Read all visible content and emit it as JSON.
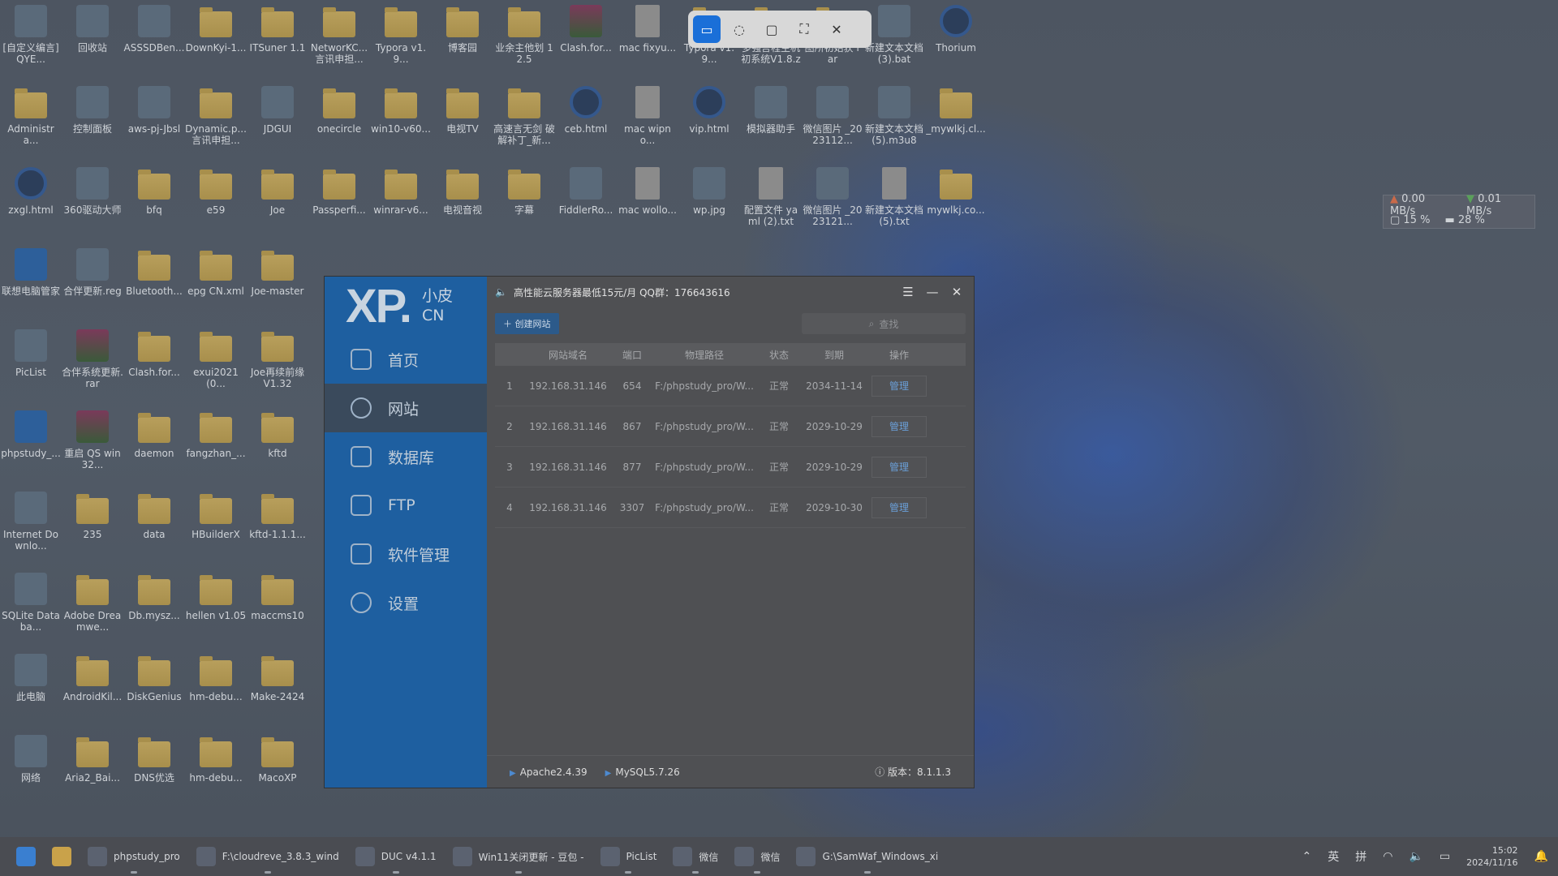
{
  "desktop": {
    "icons": [
      {
        "label": "[自定义编言] QYE...",
        "kind": "app",
        "col": 0,
        "row": 0
      },
      {
        "label": "回收站",
        "kind": "app",
        "col": 1,
        "row": 0
      },
      {
        "label": "ASSSDBen...",
        "kind": "app",
        "col": 2,
        "row": 0
      },
      {
        "label": "DownKyi-1...",
        "kind": "folder",
        "col": 3,
        "row": 0
      },
      {
        "label": "ITSuner 1.1",
        "kind": "folder",
        "col": 4,
        "row": 0
      },
      {
        "label": "NetworKC... 言讯申担...",
        "kind": "folder",
        "col": 5,
        "row": 0
      },
      {
        "label": "Typora v1.9...",
        "kind": "folder",
        "col": 6,
        "row": 0
      },
      {
        "label": "博客园",
        "kind": "folder",
        "col": 7,
        "row": 0
      },
      {
        "label": "业余主他划 12.5",
        "kind": "folder",
        "col": 8,
        "row": 0
      },
      {
        "label": "Clash.for...",
        "kind": "winrar",
        "col": 9,
        "row": 0
      },
      {
        "label": "mac fixyu...",
        "kind": "file",
        "col": 10,
        "row": 0
      },
      {
        "label": "Typora v1.9...",
        "kind": "folder",
        "col": 11,
        "row": 0
      },
      {
        "label": "多强言程主机 初系统V1.8.zip",
        "kind": "folder",
        "col": 12,
        "row": 0
      },
      {
        "label": "图所初始获 rar",
        "kind": "folder",
        "col": 13,
        "row": 0
      },
      {
        "label": "新建文本文档 (3).bat",
        "kind": "app",
        "col": 14,
        "row": 0
      },
      {
        "label": "Thorium",
        "kind": "circle",
        "col": 15,
        "row": 0
      },
      {
        "label": "Administra...",
        "kind": "folder",
        "col": 0,
        "row": 1
      },
      {
        "label": "控制面板",
        "kind": "app",
        "col": 1,
        "row": 1
      },
      {
        "label": "aws-pj-Jbsl",
        "kind": "app",
        "col": 2,
        "row": 1
      },
      {
        "label": "Dynamic.p... 言讯申担...",
        "kind": "folder",
        "col": 3,
        "row": 1
      },
      {
        "label": "JDGUI",
        "kind": "app",
        "col": 4,
        "row": 1
      },
      {
        "label": "onecircle",
        "kind": "folder",
        "col": 5,
        "row": 1
      },
      {
        "label": "win10-v60...",
        "kind": "folder",
        "col": 6,
        "row": 1
      },
      {
        "label": "电视TV",
        "kind": "folder",
        "col": 7,
        "row": 1
      },
      {
        "label": "高速言无剑 破解补丁_新...",
        "kind": "folder",
        "col": 8,
        "row": 1
      },
      {
        "label": "ceb.html",
        "kind": "circle",
        "col": 9,
        "row": 1
      },
      {
        "label": "mac wipno...",
        "kind": "file",
        "col": 10,
        "row": 1
      },
      {
        "label": "vip.html",
        "kind": "circle",
        "col": 11,
        "row": 1
      },
      {
        "label": "模拟器助手",
        "kind": "app",
        "col": 12,
        "row": 1
      },
      {
        "label": "微信图片 _2023112...",
        "kind": "app",
        "col": 13,
        "row": 1
      },
      {
        "label": "新建文本文档 (5).m3u8",
        "kind": "app",
        "col": 14,
        "row": 1
      },
      {
        "label": "_mywlkj.cl...",
        "kind": "folder",
        "col": 15,
        "row": 1
      },
      {
        "label": "zxgl.html",
        "kind": "circle",
        "col": 0,
        "row": 2
      },
      {
        "label": "360驱动大师",
        "kind": "app",
        "col": 1,
        "row": 2
      },
      {
        "label": "bfq",
        "kind": "folder",
        "col": 2,
        "row": 2
      },
      {
        "label": "e59",
        "kind": "folder",
        "col": 3,
        "row": 2
      },
      {
        "label": "Joe",
        "kind": "folder",
        "col": 4,
        "row": 2
      },
      {
        "label": "Passperfi...",
        "kind": "folder",
        "col": 5,
        "row": 2
      },
      {
        "label": "winrar-v6...",
        "kind": "folder",
        "col": 6,
        "row": 2
      },
      {
        "label": "电视音视",
        "kind": "folder",
        "col": 7,
        "row": 2
      },
      {
        "label": "字幕",
        "kind": "folder",
        "col": 8,
        "row": 2
      },
      {
        "label": "FiddlerRo...",
        "kind": "app",
        "col": 9,
        "row": 2
      },
      {
        "label": "mac wollo...",
        "kind": "file",
        "col": 10,
        "row": 2
      },
      {
        "label": "wp.jpg",
        "kind": "app",
        "col": 11,
        "row": 2
      },
      {
        "label": "配置文件 yaml (2).txt",
        "kind": "file",
        "col": 12,
        "row": 2
      },
      {
        "label": "微信图片 _2023121...",
        "kind": "app",
        "col": 13,
        "row": 2
      },
      {
        "label": "新建文本文档 (5).txt",
        "kind": "file",
        "col": 14,
        "row": 2
      },
      {
        "label": "mywlkj.co...",
        "kind": "folder",
        "col": 15,
        "row": 2
      },
      {
        "label": "联想电脑管家",
        "kind": "blue",
        "col": 0,
        "row": 3
      },
      {
        "label": "合伴更新.reg",
        "kind": "app",
        "col": 1,
        "row": 3
      },
      {
        "label": "Bluetooth...",
        "kind": "folder",
        "col": 2,
        "row": 3
      },
      {
        "label": "epg CN.xml",
        "kind": "folder",
        "col": 3,
        "row": 3
      },
      {
        "label": "Joe-master",
        "kind": "folder",
        "col": 4,
        "row": 3
      },
      {
        "label": "PicList",
        "kind": "app",
        "col": 0,
        "row": 4
      },
      {
        "label": "合伴系统更新.rar",
        "kind": "winrar",
        "col": 1,
        "row": 4
      },
      {
        "label": "Clash.for...",
        "kind": "folder",
        "col": 2,
        "row": 4
      },
      {
        "label": "exui2021(0...",
        "kind": "folder",
        "col": 3,
        "row": 4
      },
      {
        "label": "Joe再续前缘 V1.32",
        "kind": "folder",
        "col": 4,
        "row": 4
      },
      {
        "label": "phpstudy_...",
        "kind": "blue",
        "col": 0,
        "row": 5
      },
      {
        "label": "重启 QS win32...",
        "kind": "winrar",
        "col": 1,
        "row": 5
      },
      {
        "label": "daemon",
        "kind": "folder",
        "col": 2,
        "row": 5
      },
      {
        "label": "fangzhan_...",
        "kind": "folder",
        "col": 3,
        "row": 5
      },
      {
        "label": "kftd",
        "kind": "folder",
        "col": 4,
        "row": 5
      },
      {
        "label": "Internet Downlo...",
        "kind": "app",
        "col": 0,
        "row": 6
      },
      {
        "label": "235",
        "kind": "folder",
        "col": 1,
        "row": 6
      },
      {
        "label": "data",
        "kind": "folder",
        "col": 2,
        "row": 6
      },
      {
        "label": "HBuilderX",
        "kind": "folder",
        "col": 3,
        "row": 6
      },
      {
        "label": "kftd-1.1.1...",
        "kind": "folder",
        "col": 4,
        "row": 6
      },
      {
        "label": "SQLite Databa...",
        "kind": "app",
        "col": 0,
        "row": 7
      },
      {
        "label": "Adobe Dreamwe...",
        "kind": "folder",
        "col": 1,
        "row": 7
      },
      {
        "label": "Db.mysz...",
        "kind": "folder",
        "col": 2,
        "row": 7
      },
      {
        "label": "hellen v1.05",
        "kind": "folder",
        "col": 3,
        "row": 7
      },
      {
        "label": "maccms10",
        "kind": "folder",
        "col": 4,
        "row": 7
      },
      {
        "label": "此电脑",
        "kind": "app",
        "col": 0,
        "row": 8
      },
      {
        "label": "AndroidKil...",
        "kind": "folder",
        "col": 1,
        "row": 8
      },
      {
        "label": "DiskGenius",
        "kind": "folder",
        "col": 2,
        "row": 8
      },
      {
        "label": "hm-debu...",
        "kind": "folder",
        "col": 3,
        "row": 8
      },
      {
        "label": "Make-2424",
        "kind": "folder",
        "col": 4,
        "row": 8
      },
      {
        "label": "网络",
        "kind": "app",
        "col": 0,
        "row": 9
      },
      {
        "label": "Aria2_Bai...",
        "kind": "folder",
        "col": 1,
        "row": 9
      },
      {
        "label": "DNS优选",
        "kind": "folder",
        "col": 2,
        "row": 9
      },
      {
        "label": "hm-debu...",
        "kind": "folder",
        "col": 3,
        "row": 9
      },
      {
        "label": "MacoXP",
        "kind": "folder",
        "col": 4,
        "row": 9
      }
    ]
  },
  "snip_toolbar": {
    "icons": [
      "rect-snip-icon",
      "freeform-snip-icon",
      "window-snip-icon",
      "fullscreen-snip-icon",
      "close-icon"
    ]
  },
  "net_widget": {
    "upload": "0.00 MB/s",
    "download": "0.01 MB/s",
    "cpu": "15 %",
    "mem": "28 %"
  },
  "app": {
    "logo_big": "XP.",
    "logo_small_1": "小皮",
    "logo_small_2": "CN",
    "nav": [
      {
        "label": "首页",
        "icon": "home-icon"
      },
      {
        "label": "网站",
        "icon": "globe-icon",
        "active": true
      },
      {
        "label": "数据库",
        "icon": "database-icon"
      },
      {
        "label": "FTP",
        "icon": "ftp-icon"
      },
      {
        "label": "软件管理",
        "icon": "sliders-icon"
      },
      {
        "label": "设置",
        "icon": "gear-icon"
      }
    ],
    "notice": "高性能云服务器最低15元/月  QQ群：176643616",
    "create_label": "创建网站",
    "search_placeholder": "查找",
    "columns": [
      "",
      "网站域名",
      "端口",
      "物理路径",
      "状态",
      "到期",
      "操作"
    ],
    "rows": [
      {
        "n": "1",
        "domain": "192.168.31.146",
        "port": "654",
        "path": "F:/phpstudy_pro/W...",
        "status": "正常",
        "expire": "2034-11-14",
        "action": "管理"
      },
      {
        "n": "2",
        "domain": "192.168.31.146",
        "port": "867",
        "path": "F:/phpstudy_pro/W...",
        "status": "正常",
        "expire": "2029-10-29",
        "action": "管理"
      },
      {
        "n": "3",
        "domain": "192.168.31.146",
        "port": "877",
        "path": "F:/phpstudy_pro/W...",
        "status": "正常",
        "expire": "2029-10-29",
        "action": "管理"
      },
      {
        "n": "4",
        "domain": "192.168.31.146",
        "port": "3307",
        "path": "F:/phpstudy_pro/W...",
        "status": "正常",
        "expire": "2029-10-30",
        "action": "管理"
      }
    ],
    "status": {
      "apache": "Apache2.4.39",
      "mysql": "MySQL5.7.26",
      "version": "版本：8.1.1.3"
    }
  },
  "taskbar": {
    "items": [
      {
        "label": "",
        "icon": "windows-start-icon"
      },
      {
        "label": "",
        "icon": "file-explorer-icon"
      },
      {
        "label": "phpstudy_pro",
        "icon": "phpstudy-icon"
      },
      {
        "label": "F:\\cloudreve_3.8.3_wind",
        "icon": "terminal-icon"
      },
      {
        "label": "DUC v4.1.1",
        "icon": "duc-icon"
      },
      {
        "label": "Win11关闭更新 - 豆包 - ",
        "icon": "browser-icon"
      },
      {
        "label": "PicList",
        "icon": "piclist-icon"
      },
      {
        "label": "微信",
        "icon": "wechat-devtools-icon"
      },
      {
        "label": "微信",
        "icon": "wechat-icon"
      },
      {
        "label": "G:\\SamWaf_Windows_xi",
        "icon": "terminal-icon"
      }
    ],
    "tray": {
      "ime1": "英",
      "ime2": "拼",
      "time": "15:02",
      "date": "2024/11/16"
    }
  }
}
